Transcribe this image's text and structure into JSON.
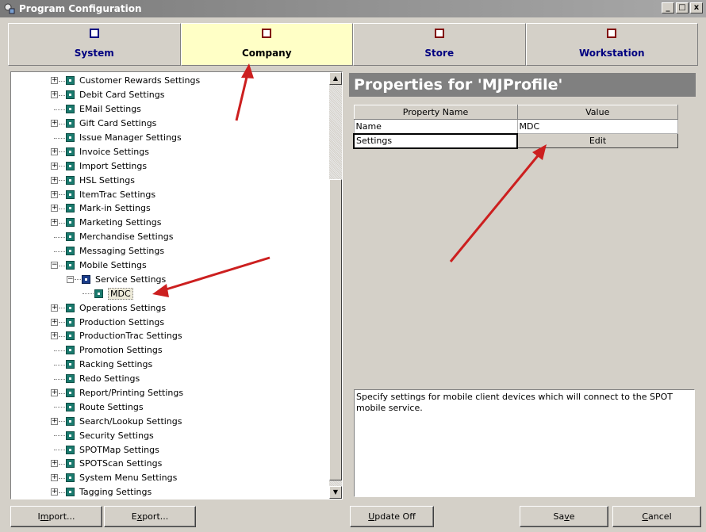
{
  "window": {
    "title": "Program Configuration",
    "controls": [
      "_",
      "□",
      "x"
    ]
  },
  "tabs": [
    {
      "label": "System",
      "active": false
    },
    {
      "label": "Company",
      "active": true
    },
    {
      "label": "Store",
      "active": false
    },
    {
      "label": "Workstation",
      "active": false
    }
  ],
  "tree": {
    "items": [
      {
        "label": "Customer Rewards Settings",
        "level": 1,
        "expandable": true
      },
      {
        "label": "Debit Card Settings",
        "level": 1,
        "expandable": true
      },
      {
        "label": "EMail Settings",
        "level": 1,
        "expandable": false
      },
      {
        "label": "Gift Card Settings",
        "level": 1,
        "expandable": true
      },
      {
        "label": "Issue Manager Settings",
        "level": 1,
        "expandable": false
      },
      {
        "label": "Invoice Settings",
        "level": 1,
        "expandable": true
      },
      {
        "label": "Import Settings",
        "level": 1,
        "expandable": true
      },
      {
        "label": "HSL Settings",
        "level": 1,
        "expandable": true
      },
      {
        "label": "ItemTrac Settings",
        "level": 1,
        "expandable": true
      },
      {
        "label": "Mark-in Settings",
        "level": 1,
        "expandable": true
      },
      {
        "label": "Marketing Settings",
        "level": 1,
        "expandable": true
      },
      {
        "label": "Merchandise Settings",
        "level": 1,
        "expandable": false
      },
      {
        "label": "Messaging Settings",
        "level": 1,
        "expandable": false
      },
      {
        "label": "Mobile Settings",
        "level": 1,
        "expandable": true,
        "expanded": true
      },
      {
        "label": "Service Settings",
        "level": 2,
        "expandable": true,
        "expanded": true
      },
      {
        "label": "MDC",
        "level": 3,
        "expandable": false,
        "selected": true
      },
      {
        "label": "Operations Settings",
        "level": 1,
        "expandable": true
      },
      {
        "label": "Production Settings",
        "level": 1,
        "expandable": true
      },
      {
        "label": "ProductionTrac Settings",
        "level": 1,
        "expandable": true
      },
      {
        "label": "Promotion Settings",
        "level": 1,
        "expandable": false
      },
      {
        "label": "Racking Settings",
        "level": 1,
        "expandable": false
      },
      {
        "label": "Redo Settings",
        "level": 1,
        "expandable": false
      },
      {
        "label": "Report/Printing Settings",
        "level": 1,
        "expandable": true
      },
      {
        "label": "Route Settings",
        "level": 1,
        "expandable": false
      },
      {
        "label": "Search/Lookup Settings",
        "level": 1,
        "expandable": true
      },
      {
        "label": "Security Settings",
        "level": 1,
        "expandable": false
      },
      {
        "label": "SPOTMap Settings",
        "level": 1,
        "expandable": false
      },
      {
        "label": "SPOTScan Settings",
        "level": 1,
        "expandable": true
      },
      {
        "label": "System Menu Settings",
        "level": 1,
        "expandable": true
      },
      {
        "label": "Tagging Settings",
        "level": 1,
        "expandable": true
      }
    ]
  },
  "properties": {
    "header": "Properties for 'MJProfile'",
    "columns": [
      "Property Name",
      "Value"
    ],
    "rows": [
      {
        "name": "Name",
        "value": "MDC"
      },
      {
        "name": "Settings",
        "value": "Edit"
      }
    ],
    "description": "Specify settings for mobile client devices which will connect to the SPOT mobile service."
  },
  "buttons": {
    "import_pre": "I",
    "import_ul": "m",
    "import_post": "port...",
    "export_pre": "E",
    "export_ul": "x",
    "export_post": "port...",
    "update_pre": "",
    "update_ul": "U",
    "update_post": "pdate Off",
    "save_pre": "Sa",
    "save_ul": "v",
    "save_post": "e",
    "cancel_pre": "",
    "cancel_ul": "C",
    "cancel_post": "ancel"
  },
  "colors": {
    "annotation_arrow": "#cc1f1f",
    "active_tab": "#ffffc6",
    "node_icon": "#1a7a6e"
  }
}
